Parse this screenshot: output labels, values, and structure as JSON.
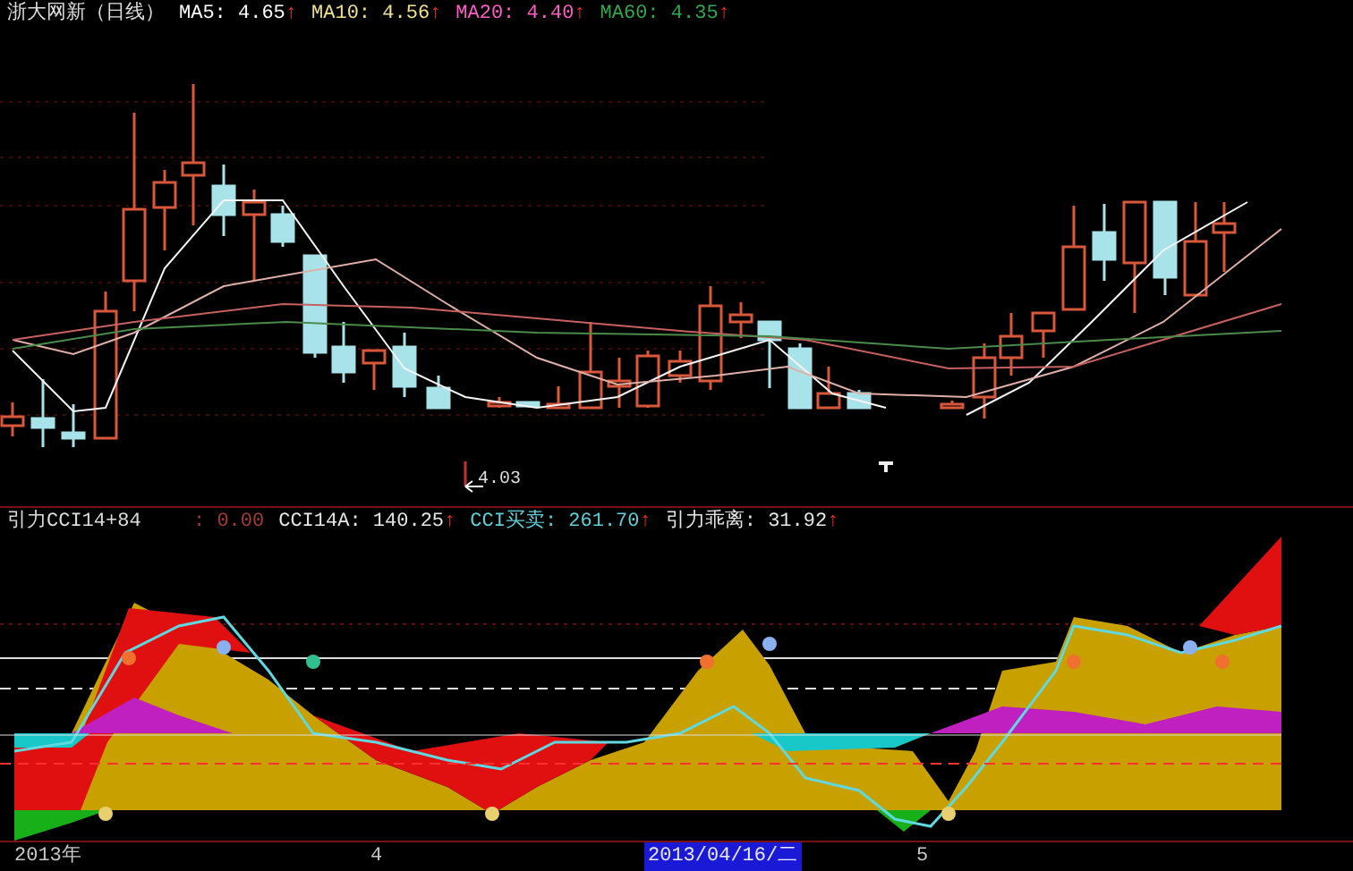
{
  "price_panel": {
    "title": "浙大网新（日线）",
    "indicators": [
      {
        "label": "MA5: 4.65",
        "arrow": "↑",
        "color": "#ffffff"
      },
      {
        "label": "MA10: 4.56",
        "arrow": "↑",
        "color": "#f0e08c"
      },
      {
        "label": "MA20: 4.40",
        "arrow": "↑",
        "color": "#ff5cc8"
      },
      {
        "label": "MA60: 4.35",
        "arrow": "↑",
        "color": "#2fa84f"
      }
    ],
    "low_price": "4.03"
  },
  "indicator_panel": {
    "name": "引力CCI14+84",
    "values": [
      {
        "label": ": 0.00",
        "color": "#a33a3a"
      },
      {
        "label": "CCI14A: 140.25",
        "arrow": "↑",
        "color": "#e6e6e6"
      },
      {
        "label": "CCI买卖: 261.70",
        "arrow": "↑",
        "color": "#5fd0d8"
      },
      {
        "label": "引力乖离: 31.92",
        "arrow": "↑",
        "color": "#e6e6e6"
      }
    ]
  },
  "time_axis": [
    {
      "label": "2013年",
      "selected": false
    },
    {
      "label": "4",
      "selected": false
    },
    {
      "label": "2013/04/16/二",
      "selected": true
    },
    {
      "label": "5",
      "selected": false
    }
  ]
}
